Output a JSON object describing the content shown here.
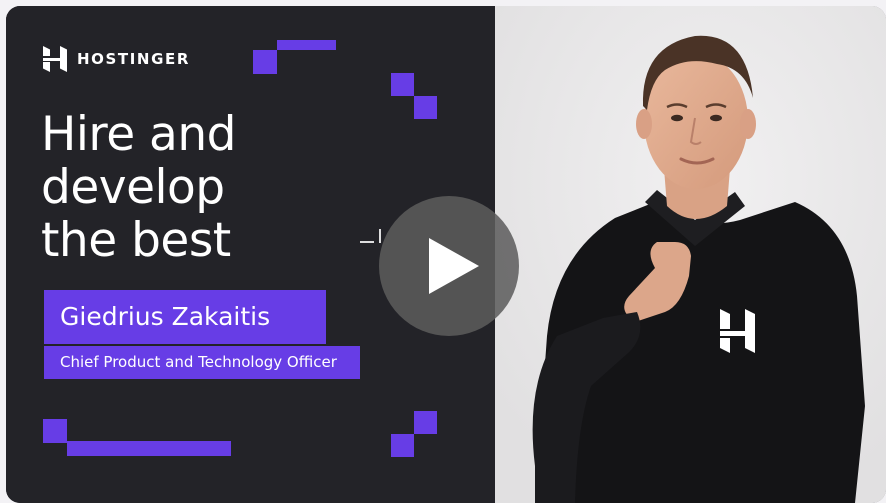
{
  "video": {
    "brand": "HOSTINGER",
    "headline_lines": [
      "Hire and",
      "develop",
      "the best"
    ],
    "person_name": "Giedrius Zakaitis",
    "person_title": "Chief Product and Technology Officer",
    "play_icon": "play-icon",
    "logo_icon": "hostinger-logo-icon"
  },
  "colors": {
    "accent": "#673de6",
    "dark_background": "#232328",
    "play_button": "#5c5c5c",
    "text": "#ffffff"
  }
}
